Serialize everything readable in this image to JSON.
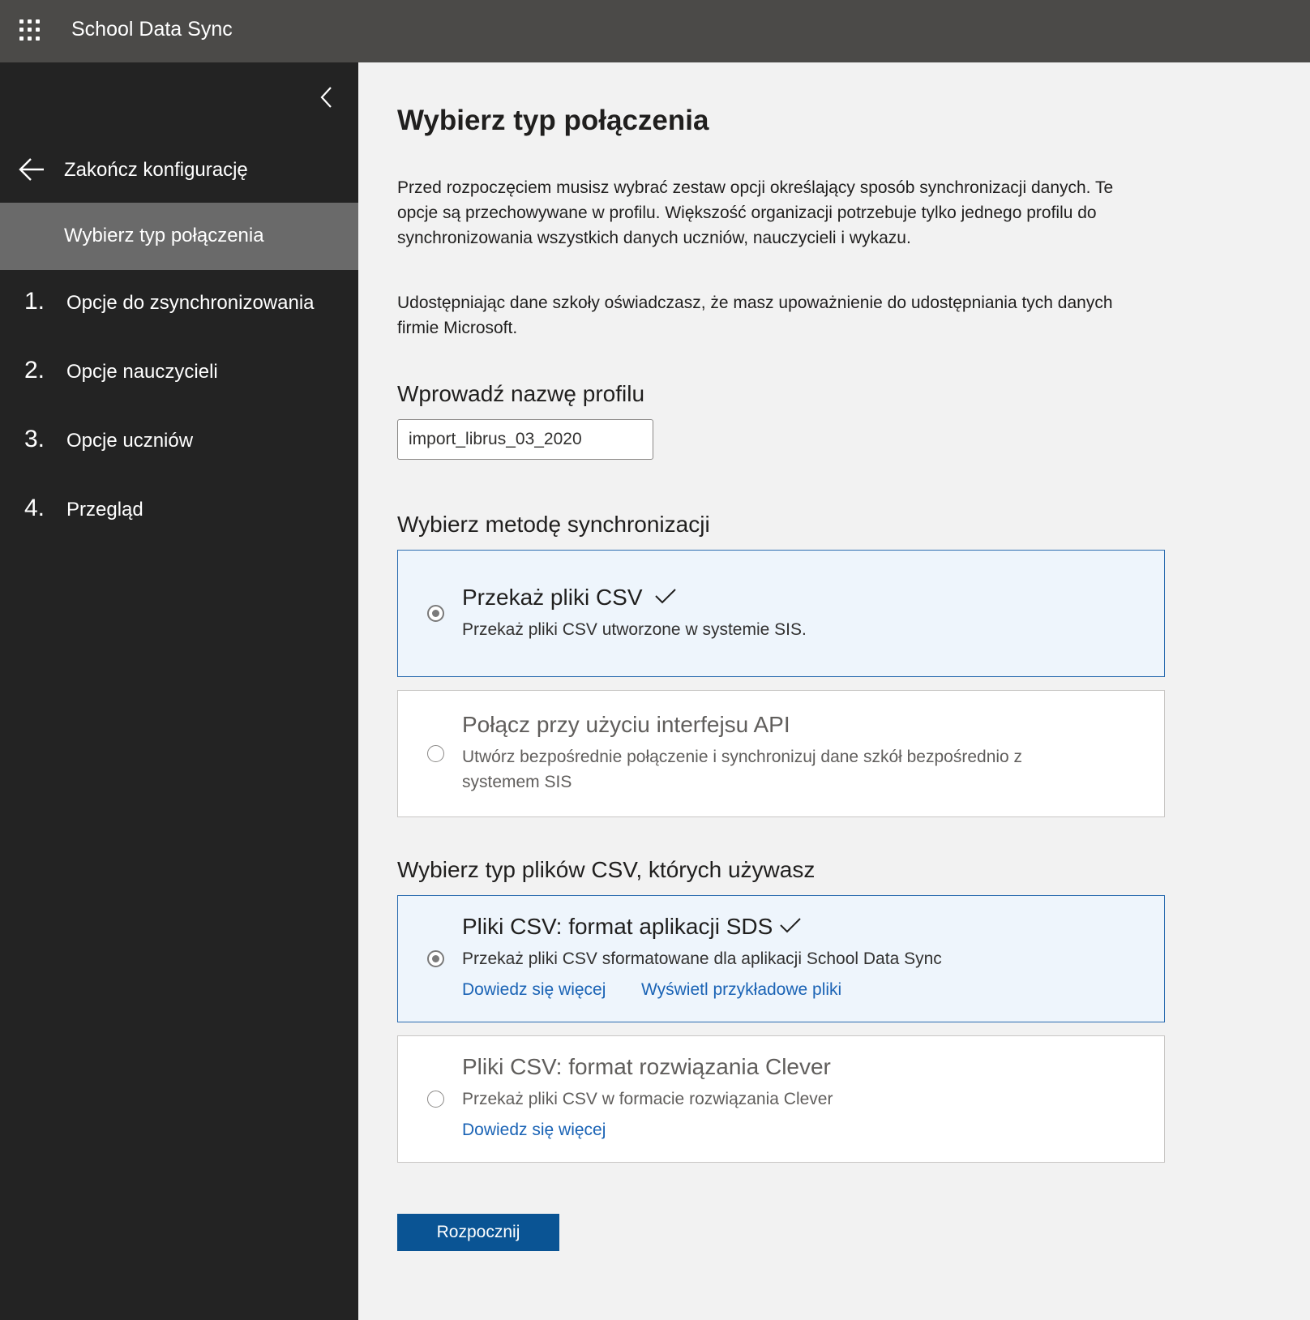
{
  "header": {
    "app_title": "School Data Sync",
    "waffle_icon": "app-launcher-icon"
  },
  "sidebar": {
    "collapse_icon": "chevron-left-icon",
    "exit": {
      "icon": "arrow-left-icon",
      "label": "Zakończ konfigurację"
    },
    "current_step": "Wybierz typ połączenia",
    "steps": [
      {
        "num": "1.",
        "label": "Opcje do zsynchronizowania"
      },
      {
        "num": "2.",
        "label": "Opcje nauczycieli"
      },
      {
        "num": "3.",
        "label": "Opcje uczniów"
      },
      {
        "num": "4.",
        "label": "Przegląd"
      }
    ]
  },
  "main": {
    "title": "Wybierz typ połączenia",
    "intro": "Przed rozpoczęciem musisz wybrać zestaw opcji określający sposób synchronizacji danych. Te opcje są przechowywane w profilu. Większość organizacji potrzebuje tylko jednego profilu do synchronizowania wszystkich danych uczniów, nauczycieli i wykazu.",
    "consent": "Udostępniając dane szkoły oświadczasz, że masz upoważnienie do udostępniania tych danych firmie Microsoft.",
    "profile_label": "Wprowadź nazwę profilu",
    "profile_value": "import_librus_03_2020",
    "sync_method_label": "Wybierz metodę synchronizacji",
    "sync_methods": [
      {
        "title": "Przekaż pliki CSV",
        "desc": "Przekaż pliki CSV utworzone w systemie SIS.",
        "selected": true
      },
      {
        "title": "Połącz przy użyciu interfejsu API",
        "desc": "Utwórz bezpośrednie połączenie i synchronizuj dane szkół bezpośrednio z systemem SIS",
        "selected": false
      }
    ],
    "csv_type_label": "Wybierz typ plików CSV, których używasz",
    "csv_types": [
      {
        "title": "Pliki CSV: format aplikacji SDS",
        "desc": "Przekaż pliki CSV sformatowane dla aplikacji School Data Sync",
        "link1": "Dowiedz się więcej",
        "link2": "Wyświetl przykładowe pliki",
        "selected": true
      },
      {
        "title": "Pliki CSV: format rozwiązania Clever",
        "desc": "Przekaż pliki CSV w formacie rozwiązania Clever",
        "link1": "Dowiedz się więcej",
        "selected": false
      }
    ],
    "start_button": "Rozpocznij"
  },
  "colors": {
    "topbar": "#4b4a48",
    "sidebar": "#232323",
    "sidebar_active": "#6a6a6a",
    "link": "#1a63b5",
    "primary_button": "#0a5494",
    "selected_card": "#eef5fc"
  }
}
